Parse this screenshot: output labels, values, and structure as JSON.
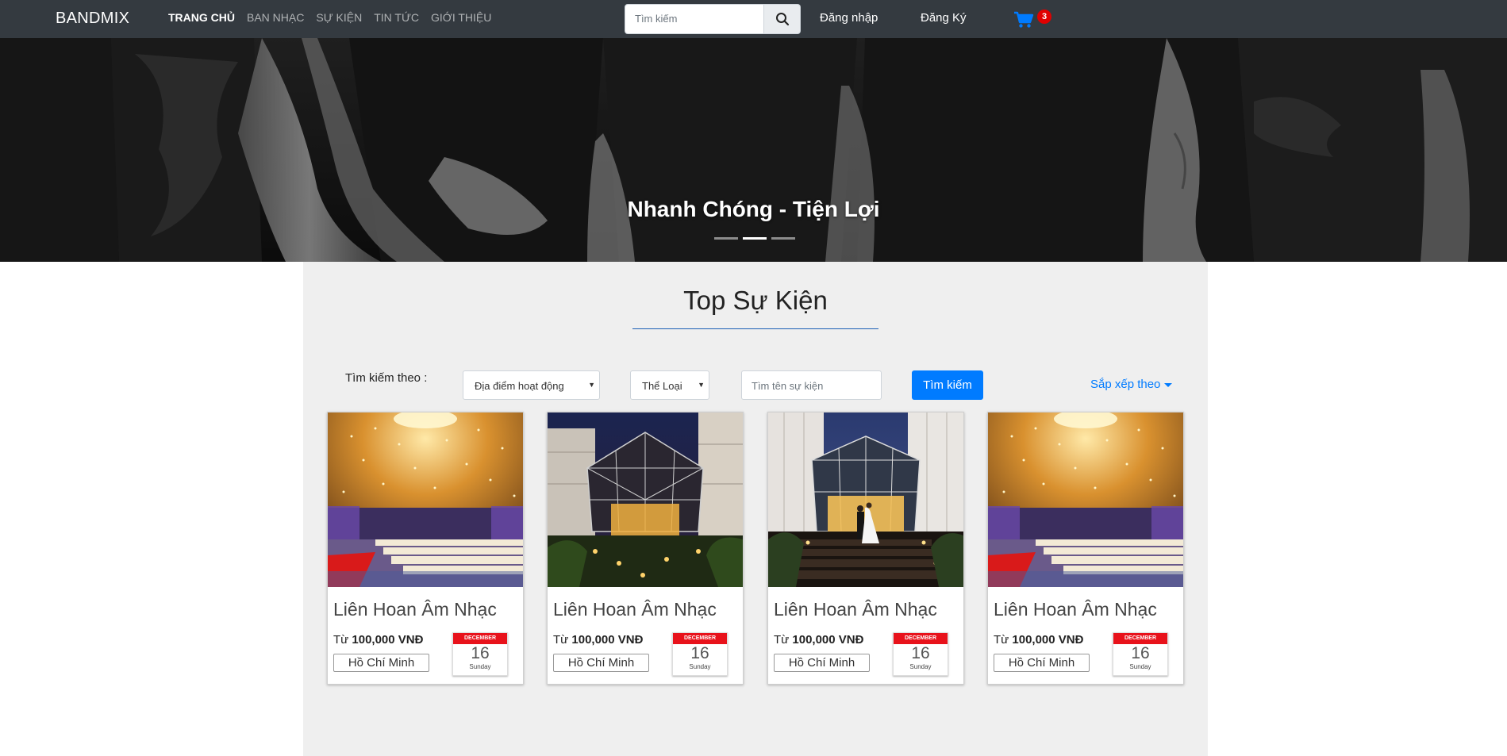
{
  "nav": {
    "brand": "BANDMIX",
    "links": [
      "TRANG CHỦ",
      "BAN NHẠC",
      "SỰ KIỆN",
      "TIN TỨC",
      "GIỚI THIỆU"
    ],
    "search_placeholder": "Tìm kiếm",
    "login": "Đăng nhập",
    "register": "Đăng Ký",
    "cart_count": "3",
    "accent_color": "#007bff",
    "cart_icon": "shopping-cart-icon",
    "search_icon": "search-icon"
  },
  "hero": {
    "caption": "Nhanh Chóng - Tiện Lợi",
    "slide_count": 3,
    "active_slide": 2
  },
  "events": {
    "title": "Top Sự Kiện",
    "filter_label": "Tìm kiếm theo :",
    "location_select": "Địa điểm hoạt động",
    "genre_select": "Thể Loại",
    "name_placeholder": "Tìm tên sự kiện",
    "search_button": "Tìm kiếm",
    "sort_label": "Sắp xếp theo",
    "cards": [
      {
        "name": "Liên Hoan Âm Nhạc",
        "price_prefix": "Từ",
        "price": "100,000 VNĐ",
        "location": "Hồ Chí Minh",
        "month": "DECEMBER",
        "day": "16",
        "weekday": "Sunday",
        "image": "ballroom"
      },
      {
        "name": "Liên Hoan Âm Nhạc",
        "price_prefix": "Từ",
        "price": "100,000 VNĐ",
        "location": "Hồ Chí Minh",
        "month": "DECEMBER",
        "day": "16",
        "weekday": "Sunday",
        "image": "glass-pavilion-night"
      },
      {
        "name": "Liên Hoan Âm Nhạc",
        "price_prefix": "Từ",
        "price": "100,000 VNĐ",
        "location": "Hồ Chí Minh",
        "month": "DECEMBER",
        "day": "16",
        "weekday": "Sunday",
        "image": "glass-entrance-wedding"
      },
      {
        "name": "Liên Hoan Âm Nhạc",
        "price_prefix": "Từ",
        "price": "100,000 VNĐ",
        "location": "Hồ Chí Minh",
        "month": "DECEMBER",
        "day": "16",
        "weekday": "Sunday",
        "image": "ballroom"
      }
    ]
  }
}
